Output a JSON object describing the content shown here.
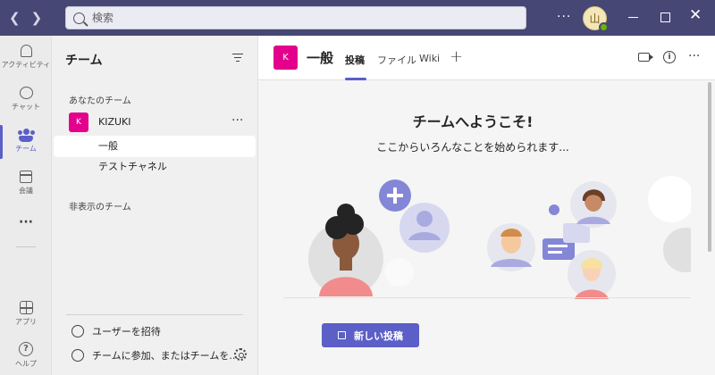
{
  "titlebar": {
    "search_placeholder": "検索",
    "more": "···",
    "user_initial": "山",
    "close": "✕"
  },
  "rail": {
    "items": [
      {
        "label": "アクティビティ",
        "icon": "bell-icon"
      },
      {
        "label": "チャット",
        "icon": "chat-icon"
      },
      {
        "label": "チーム",
        "icon": "teams-icon"
      },
      {
        "label": "会議",
        "icon": "calendar-icon"
      },
      {
        "label": "···",
        "icon": "more-icon"
      },
      {
        "label": "アプリ",
        "icon": "apps-icon"
      },
      {
        "label": "ヘルプ",
        "icon": "help-icon"
      }
    ],
    "accent": "#5b5fc7"
  },
  "panel": {
    "title": "チーム",
    "your_teams_label": "あなたのチーム",
    "team": {
      "initial": "K",
      "name": "KIZUKI",
      "more": "···",
      "color": "#e3008c"
    },
    "channels": [
      "一般",
      "テストチャネル"
    ],
    "hidden_label": "非表示のチーム",
    "invite_label": "ユーザーを招待",
    "join_label": "チームに参加、またはチームを..."
  },
  "main": {
    "channel_initial": "K",
    "channel_name": "一般",
    "tabs": [
      "投稿",
      "ファイル",
      "Wiki"
    ],
    "add_tab": "+",
    "info": "i",
    "more": "···",
    "welcome_title": "チームへようこそ!",
    "welcome_sub": "ここからいろんなことを始められます...",
    "new_post_label": "新しい投稿"
  }
}
